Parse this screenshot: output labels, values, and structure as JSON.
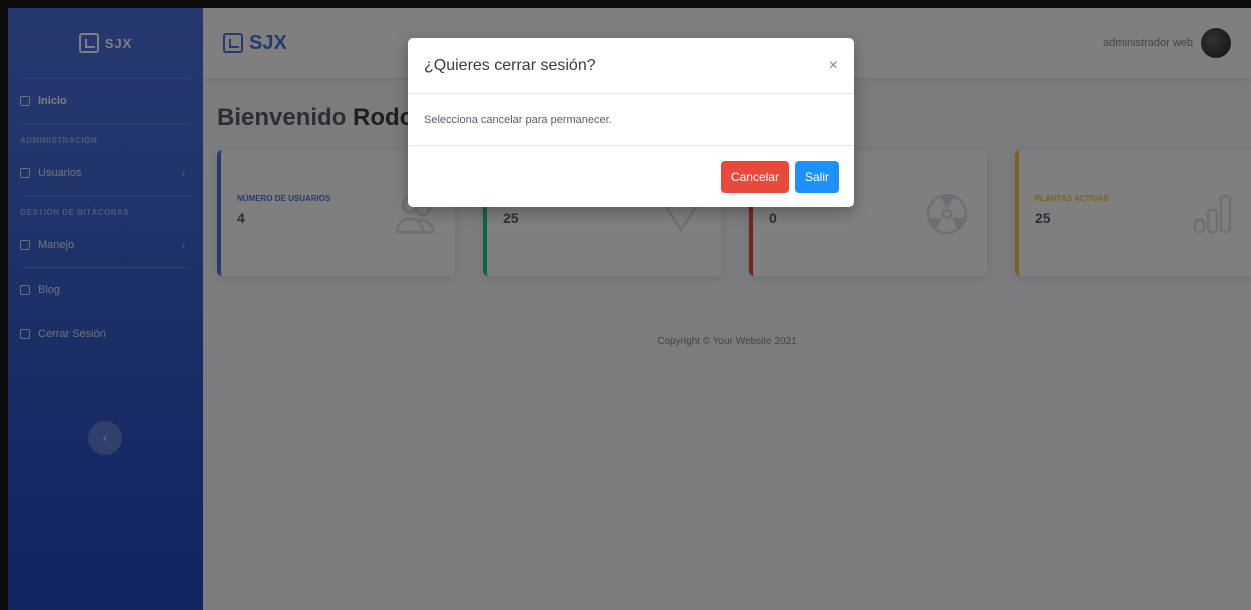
{
  "sidebar": {
    "brand": "SJX",
    "items": [
      {
        "label": "Inicio",
        "icon": "home-icon"
      },
      {
        "heading": "Administración"
      },
      {
        "label": "Usuarios",
        "icon": "users-icon"
      },
      {
        "heading": "Gestión de Bitácoras"
      },
      {
        "label": "Manejo",
        "icon": "gear-icon"
      },
      {
        "label": "Blog",
        "icon": "blog-icon"
      },
      {
        "label": "Cerrar Sesión",
        "icon": "logout-icon"
      }
    ],
    "toggle_glyph": "‹"
  },
  "topbar": {
    "brand": "SJX",
    "user_name": "administrador web"
  },
  "main": {
    "greeting": "Bienvenido",
    "user_first_name": "Rodo",
    "cards": [
      {
        "label": "Número de usuarios",
        "value": "4",
        "color": "#4e73df",
        "icon": "users-icon"
      },
      {
        "label": "",
        "value": "25",
        "color": "#1cc88a",
        "icon": "arrow-down-icon"
      },
      {
        "label": "",
        "value": "0",
        "color": "#e74a3b",
        "icon": "radiation-icon"
      },
      {
        "label": "Plantas activas",
        "value": "25",
        "color": "#f6c23e",
        "icon": "bar-chart-icon"
      }
    ],
    "footer": "Copyright © Your Website 2021"
  },
  "modal": {
    "title": "¿Quieres cerrar sesión?",
    "close_glyph": "×",
    "body": "Selecciona cancelar para permanecer.",
    "cancel_label": "Cancelar",
    "exit_label": "Salir"
  },
  "colors": {
    "primary": "#4e73df",
    "danger": "#e74a3b",
    "button_blue": "#1e90ff"
  }
}
